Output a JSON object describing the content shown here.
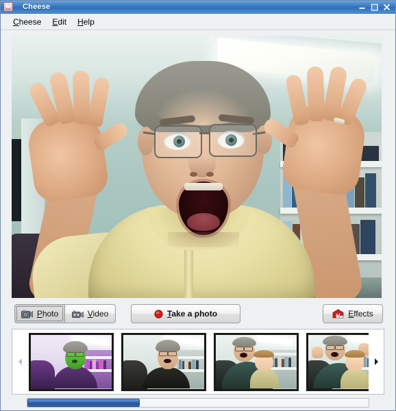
{
  "window": {
    "title": "Cheese",
    "app_icon": "cheese-app-icon",
    "controls": [
      {
        "name": "minimize-button",
        "glyph": "minimize-icon"
      },
      {
        "name": "maximize-button",
        "glyph": "maximize-icon"
      },
      {
        "name": "close-button",
        "glyph": "close-icon"
      }
    ],
    "titlebar_color": "#2e70bd",
    "chrome_color": "#eef0f2"
  },
  "menubar": {
    "items": [
      {
        "mnemonic": "C",
        "rest": "heese"
      },
      {
        "mnemonic": "E",
        "rest": "dit"
      },
      {
        "mnemonic": "H",
        "rest": "elp"
      }
    ]
  },
  "viewport": {
    "label": "webcam-live-preview",
    "description": "Live webcam preview of a man with glasses in a yellow polo shirt making a wide-eyed open-mouthed surprised expression with both hands raised, in an office with a bookshelf and fluorescent ceiling light"
  },
  "toolbar": {
    "photo": {
      "mnemonic": "P",
      "rest": "hoto",
      "icon": "photo-camera-icon",
      "active": true
    },
    "video": {
      "mnemonic": "V",
      "rest": "ideo",
      "icon": "video-camera-icon",
      "active": false
    },
    "take_photo": {
      "mnemonic": "T",
      "rest": "ake a photo",
      "icon": "record-dot-icon",
      "accent": "#d41f1f"
    },
    "effects": {
      "mnemonic": "E",
      "rest": "ffects",
      "icon": "effects-icon",
      "accent": "#cc2222"
    }
  },
  "thumbnail_strip": {
    "prev_arrow": "chevron-left-icon",
    "next_arrow": "chevron-right-icon",
    "thumbnails": [
      {
        "name": "thumbnail-1",
        "caption": "Man with green-tinted face effect in purple shirt",
        "skin": "#5fc03a",
        "shirt": "#472a5e",
        "chair": "#4a2a5c",
        "shelf": "#8d5fa8",
        "effect": "green"
      },
      {
        "name": "thumbnail-2",
        "caption": "Man in dark striped shirt with open mouth",
        "skin": "#e6c3a2",
        "shirt": "#23231f",
        "chair": "#2b2b28",
        "shelf": "#a9b6b0",
        "effect": "none"
      },
      {
        "name": "thumbnail-3",
        "caption": "Man laughing with a toddler on his lap",
        "skin": "#e8c6a4",
        "shirt": "#2f4a43",
        "chair": "#2a3b38",
        "shelf": "#b3bfb8",
        "effect": "none"
      },
      {
        "name": "thumbnail-4",
        "caption": "Man with hands raised and a toddler on his lap",
        "skin": "#e9c8a6",
        "shirt": "#30504a",
        "chair": "#2c3e3a",
        "shelf": "#b6c2bb",
        "effect": "none"
      }
    ]
  },
  "scrollbar": {
    "name": "thumbnail-strip-scrollbar",
    "orientation": "horizontal",
    "thumb_percent": 33,
    "thumb_color": "#27549f"
  }
}
